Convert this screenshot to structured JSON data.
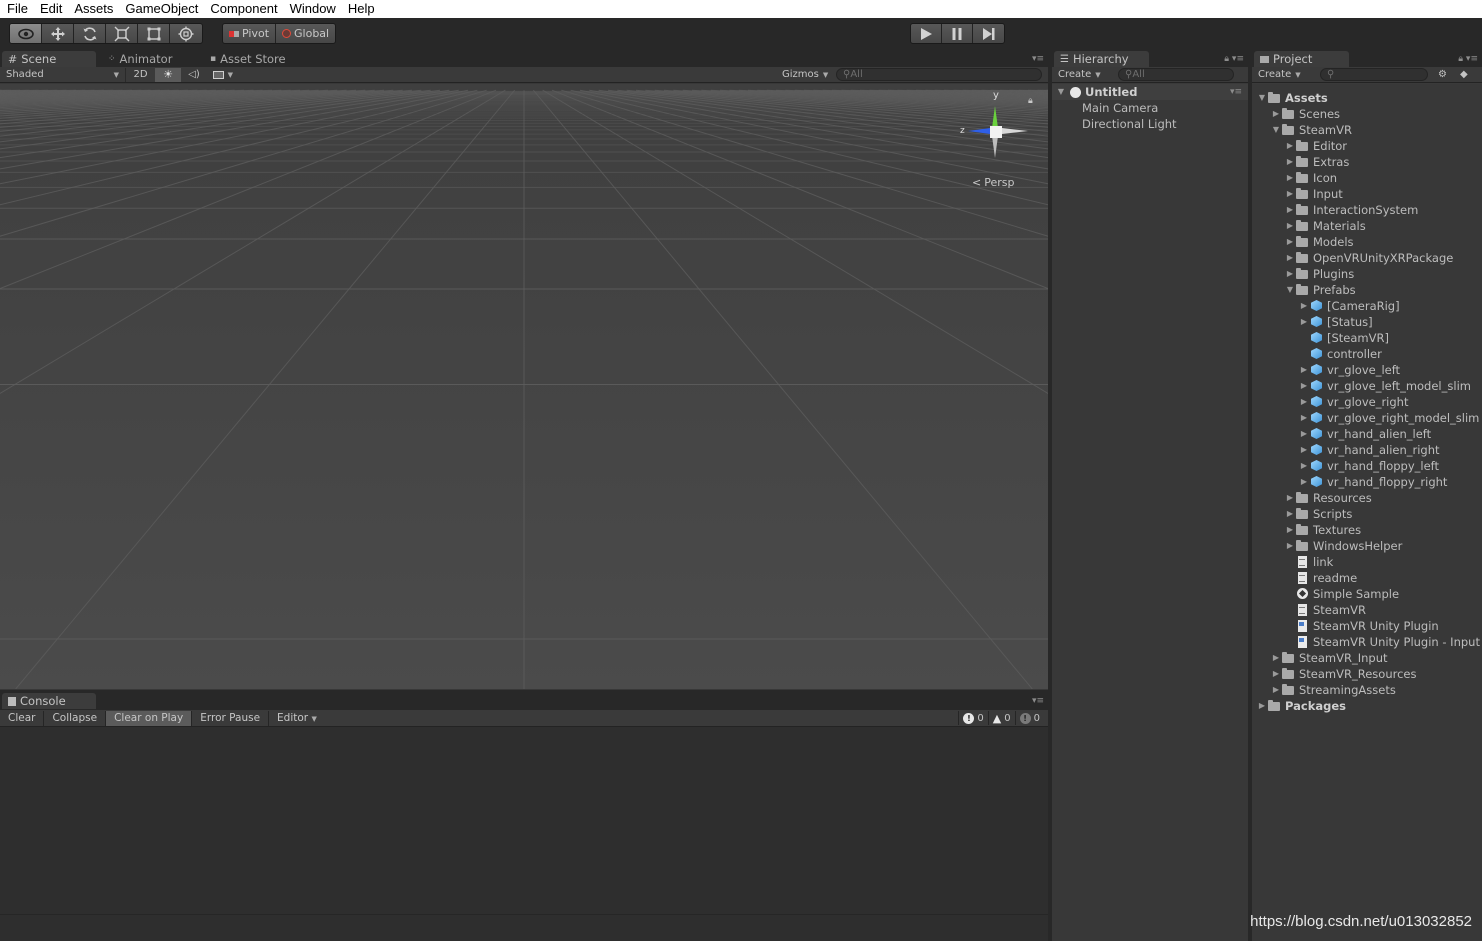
{
  "menubar": [
    "File",
    "Edit",
    "Assets",
    "GameObject",
    "Component",
    "Window",
    "Help"
  ],
  "toolbar": {
    "tools": [
      "view-tool",
      "move-tool",
      "rotate-tool",
      "scale-tool",
      "rect-tool",
      "transform-tool"
    ],
    "active_tool": "view-tool",
    "pivot_label": "Pivot",
    "global_label": "Global",
    "play_controls": [
      "play",
      "pause",
      "step"
    ]
  },
  "scene": {
    "tabs": [
      "Scene",
      "Animator",
      "Asset Store"
    ],
    "active_tab": "Scene",
    "shading_mode": "Shaded",
    "mode_2d_label": "2D",
    "gizmos_label": "Gizmos",
    "search_placeholder": "All",
    "gizmo": {
      "y_label": "y",
      "z_label": "z",
      "projection_label": "Persp"
    }
  },
  "console": {
    "tab_label": "Console",
    "buttons": [
      "Clear",
      "Collapse",
      "Clear on Play",
      "Error Pause",
      "Editor"
    ],
    "active_button": "Clear on Play",
    "counts": {
      "info": "0",
      "warning": "0",
      "error": "0"
    }
  },
  "hierarchy": {
    "tab_label": "Hierarchy",
    "create_label": "Create",
    "search_placeholder": "All",
    "scene_name": "Untitled",
    "items": [
      "Main Camera",
      "Directional Light"
    ]
  },
  "project": {
    "tab_label": "Project",
    "create_label": "Create",
    "tree": [
      {
        "label": "Assets",
        "depth": 0,
        "arrow": "open",
        "icon": "folder",
        "bold": true
      },
      {
        "label": "Scenes",
        "depth": 1,
        "arrow": "closed",
        "icon": "folder"
      },
      {
        "label": "SteamVR",
        "depth": 1,
        "arrow": "open",
        "icon": "folder"
      },
      {
        "label": "Editor",
        "depth": 2,
        "arrow": "closed",
        "icon": "folder"
      },
      {
        "label": "Extras",
        "depth": 2,
        "arrow": "closed",
        "icon": "folder"
      },
      {
        "label": "Icon",
        "depth": 2,
        "arrow": "closed",
        "icon": "folder"
      },
      {
        "label": "Input",
        "depth": 2,
        "arrow": "closed",
        "icon": "folder"
      },
      {
        "label": "InteractionSystem",
        "depth": 2,
        "arrow": "closed",
        "icon": "folder"
      },
      {
        "label": "Materials",
        "depth": 2,
        "arrow": "closed",
        "icon": "folder"
      },
      {
        "label": "Models",
        "depth": 2,
        "arrow": "closed",
        "icon": "folder"
      },
      {
        "label": "OpenVRUnityXRPackage",
        "depth": 2,
        "arrow": "closed",
        "icon": "folder"
      },
      {
        "label": "Plugins",
        "depth": 2,
        "arrow": "closed",
        "icon": "folder"
      },
      {
        "label": "Prefabs",
        "depth": 2,
        "arrow": "open",
        "icon": "folder"
      },
      {
        "label": "[CameraRig]",
        "depth": 3,
        "arrow": "closed",
        "icon": "prefab"
      },
      {
        "label": "[Status]",
        "depth": 3,
        "arrow": "closed",
        "icon": "prefab"
      },
      {
        "label": "[SteamVR]",
        "depth": 3,
        "arrow": "none",
        "icon": "prefab"
      },
      {
        "label": "controller",
        "depth": 3,
        "arrow": "none",
        "icon": "prefab"
      },
      {
        "label": "vr_glove_left",
        "depth": 3,
        "arrow": "closed",
        "icon": "prefab"
      },
      {
        "label": "vr_glove_left_model_slim",
        "depth": 3,
        "arrow": "closed",
        "icon": "prefab"
      },
      {
        "label": "vr_glove_right",
        "depth": 3,
        "arrow": "closed",
        "icon": "prefab"
      },
      {
        "label": "vr_glove_right_model_slim",
        "depth": 3,
        "arrow": "closed",
        "icon": "prefab"
      },
      {
        "label": "vr_hand_alien_left",
        "depth": 3,
        "arrow": "closed",
        "icon": "prefab"
      },
      {
        "label": "vr_hand_alien_right",
        "depth": 3,
        "arrow": "closed",
        "icon": "prefab"
      },
      {
        "label": "vr_hand_floppy_left",
        "depth": 3,
        "arrow": "closed",
        "icon": "prefab"
      },
      {
        "label": "vr_hand_floppy_right",
        "depth": 3,
        "arrow": "closed",
        "icon": "prefab"
      },
      {
        "label": "Resources",
        "depth": 2,
        "arrow": "closed",
        "icon": "folder"
      },
      {
        "label": "Scripts",
        "depth": 2,
        "arrow": "closed",
        "icon": "folder"
      },
      {
        "label": "Textures",
        "depth": 2,
        "arrow": "closed",
        "icon": "folder"
      },
      {
        "label": "WindowsHelper",
        "depth": 2,
        "arrow": "closed",
        "icon": "folder"
      },
      {
        "label": "link",
        "depth": 2,
        "arrow": "none",
        "icon": "doc"
      },
      {
        "label": "readme",
        "depth": 2,
        "arrow": "none",
        "icon": "doc"
      },
      {
        "label": "Simple Sample",
        "depth": 2,
        "arrow": "none",
        "icon": "scene"
      },
      {
        "label": "SteamVR",
        "depth": 2,
        "arrow": "none",
        "icon": "doc"
      },
      {
        "label": "SteamVR Unity Plugin",
        "depth": 2,
        "arrow": "none",
        "icon": "pdf"
      },
      {
        "label": "SteamVR Unity Plugin - Input",
        "depth": 2,
        "arrow": "none",
        "icon": "pdf"
      },
      {
        "label": "SteamVR_Input",
        "depth": 1,
        "arrow": "closed",
        "icon": "folder"
      },
      {
        "label": "SteamVR_Resources",
        "depth": 1,
        "arrow": "closed",
        "icon": "folder"
      },
      {
        "label": "StreamingAssets",
        "depth": 1,
        "arrow": "closed",
        "icon": "folder"
      },
      {
        "label": "Packages",
        "depth": 0,
        "arrow": "closed",
        "icon": "folder",
        "bold": true
      }
    ]
  },
  "watermark": "https://blog.csdn.net/u013032852",
  "colors": {
    "editor_bg": "#282828",
    "panel_bg": "#383838",
    "y_axis": "#6ad13e",
    "z_axis": "#2f5fe8",
    "x_axis": "#e0e0e0"
  }
}
